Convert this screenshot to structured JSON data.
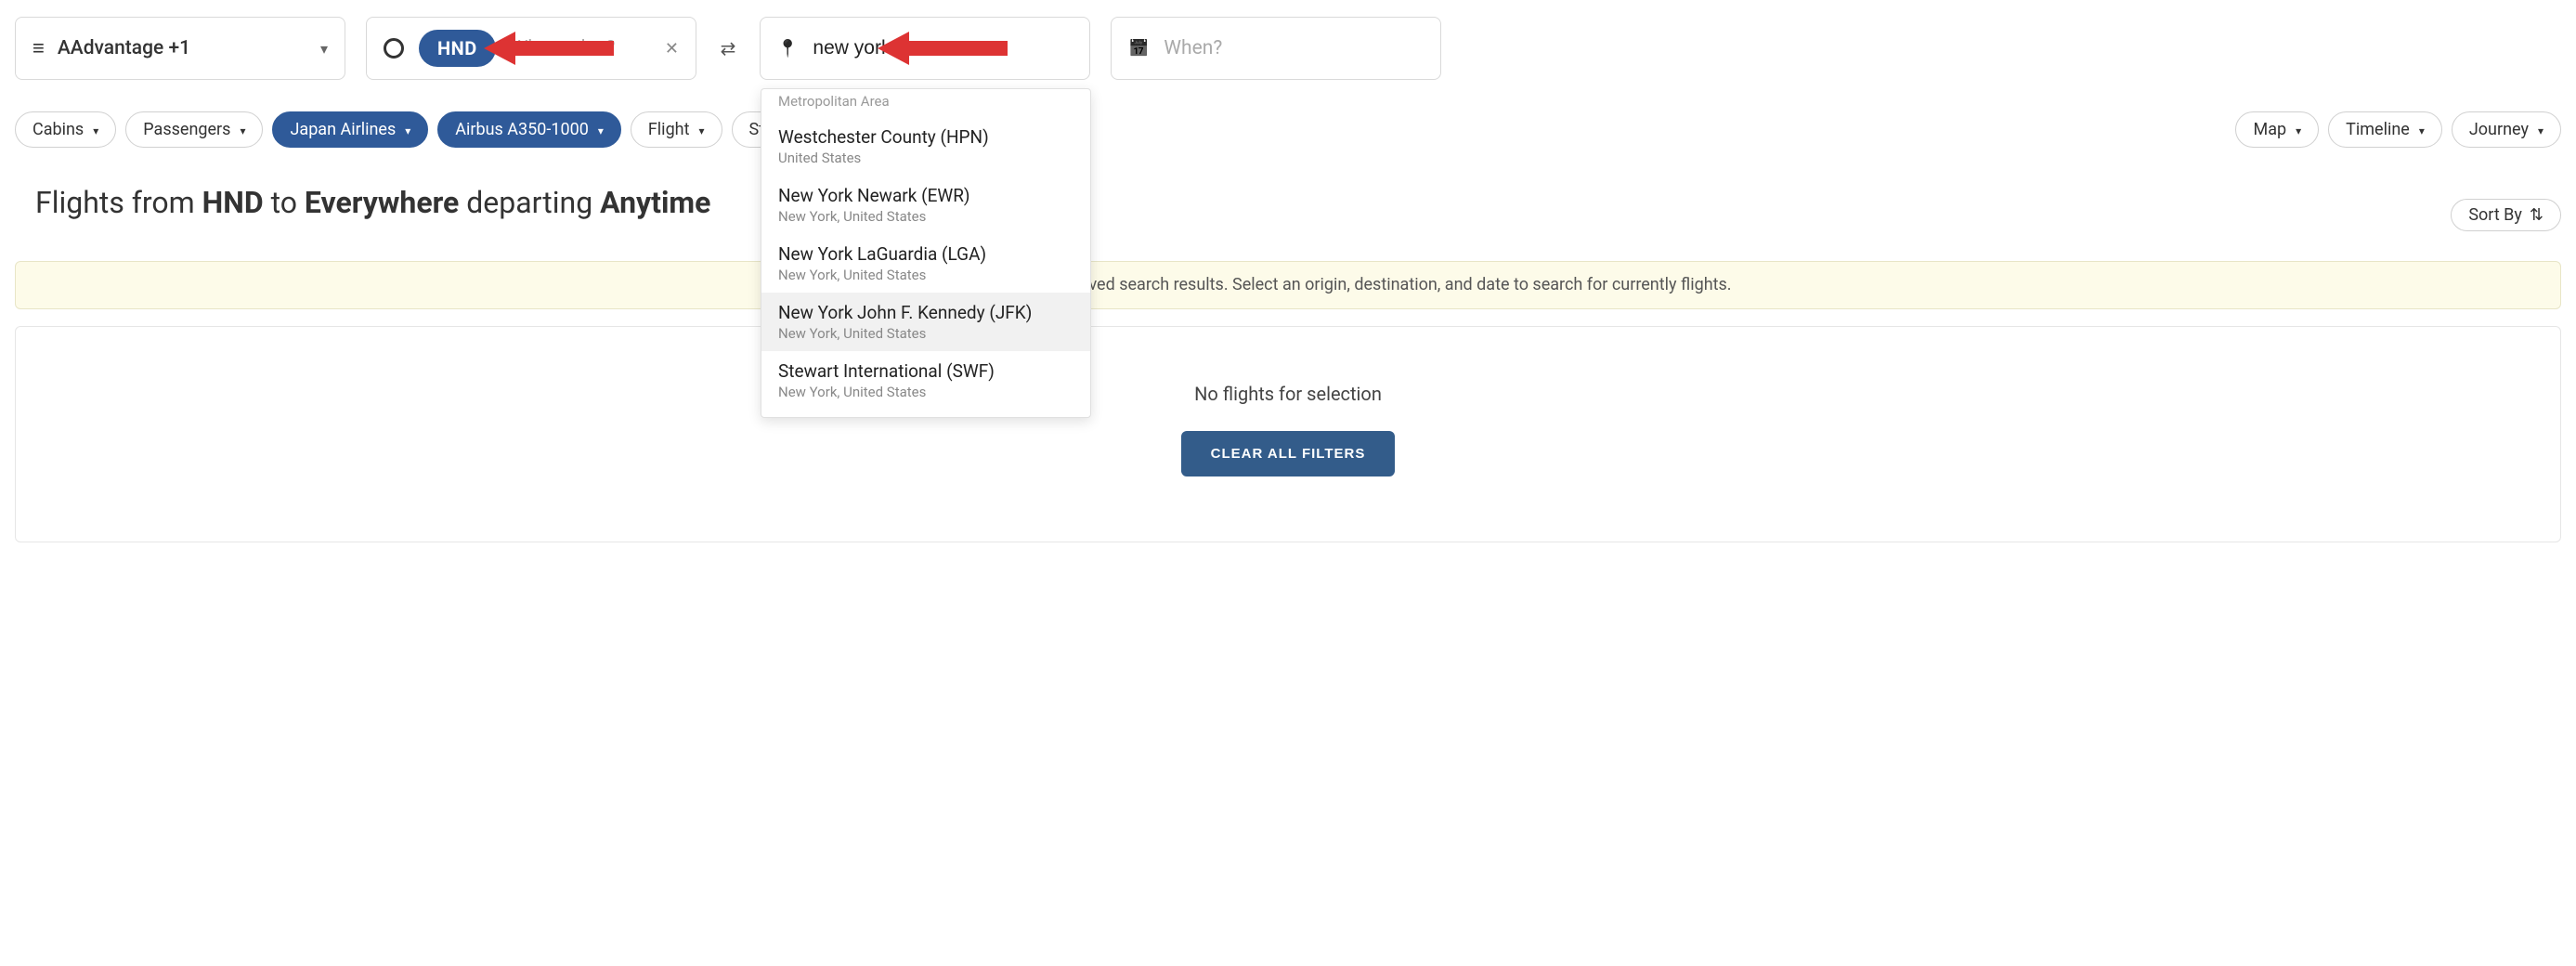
{
  "program": {
    "label": "AAdvantage +1"
  },
  "origin": {
    "tag": "HND",
    "placeholder": "Where else?"
  },
  "destination": {
    "value": "new york"
  },
  "when": {
    "placeholder": "When?"
  },
  "filters": {
    "cabins": "Cabins",
    "passengers": "Passengers",
    "airline": "Japan Airlines",
    "aircraft": "Airbus A350-1000",
    "flight": "Flight",
    "stops": "Stops",
    "map": "Map",
    "timeline": "Timeline",
    "journey": "Journey"
  },
  "headline": {
    "p1": "Flights from ",
    "b1": "HND",
    "p2": " to ",
    "b2": "Everywhere",
    "p3": " departing ",
    "b3": "Anytime"
  },
  "sort": {
    "label": "Sort By"
  },
  "banner": {
    "text": "Broad searches only show saved search results. Select an origin, destination, and date to search for currently flights."
  },
  "results": {
    "empty": "No flights for selection",
    "clear": "CLEAR ALL FILTERS"
  },
  "suggest": {
    "metro_label": "Metropolitan Area",
    "items": [
      {
        "title": "Westchester County (HPN)",
        "sub": "United States"
      },
      {
        "title": "New York Newark (EWR)",
        "sub": "New York, United States"
      },
      {
        "title": "New York LaGuardia (LGA)",
        "sub": "New York, United States"
      },
      {
        "title": "New York John F. Kennedy (JFK)",
        "sub": "New York, United States",
        "highlight": true
      },
      {
        "title": "Stewart International (SWF)",
        "sub": "New York, United States"
      }
    ]
  }
}
